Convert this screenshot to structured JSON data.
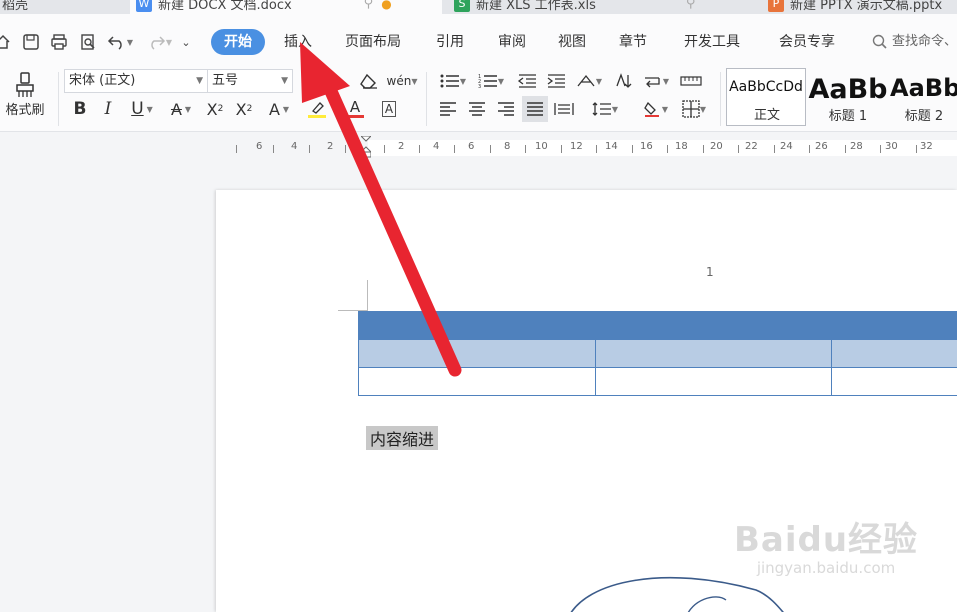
{
  "tabs": [
    {
      "label": "稻壳",
      "icon": "wps-logo-icon",
      "color": "#e0e3e8"
    },
    {
      "label": "新建 DOCX 文档.docx",
      "icon": "writer-doc-icon",
      "color": "#4a8ef0",
      "active": true
    },
    {
      "label": "新建 XLS 工作表.xls",
      "icon": "sheet-doc-icon",
      "color": "#2ea35c"
    },
    {
      "label": "新建 PPTX 演示文稿.pptx",
      "icon": "slides-doc-icon",
      "color": "#e8743b"
    }
  ],
  "menu": {
    "items": [
      "开始",
      "插入",
      "页面布局",
      "引用",
      "审阅",
      "视图",
      "章节",
      "开发工具",
      "会员专享"
    ],
    "active": "开始",
    "search_label": "查找命令、"
  },
  "ribbon": {
    "format_painter_label": "格式刷",
    "font_name": "宋体 (正文)",
    "font_size": "五号",
    "styles": [
      {
        "sample": "AaBbCcDd",
        "name": "正文"
      },
      {
        "sample": "AaBb",
        "name": "标题 1"
      },
      {
        "sample": "AaBb",
        "name": "标题 2"
      }
    ],
    "accent_color": "#4a90e2",
    "highlight_color": "#ffeb3b",
    "font_color": "#e53935"
  },
  "ruler": {
    "left_ticks": [
      "6",
      "4",
      "2"
    ],
    "right_ticks": [
      "2",
      "4",
      "6",
      "8",
      "10",
      "12",
      "14",
      "16",
      "18",
      "20",
      "22",
      "24",
      "26",
      "28",
      "30",
      "32"
    ]
  },
  "document": {
    "page_number": "1",
    "paragraph": "内容缩进",
    "table": {
      "header_color": "#4f81bd",
      "band_color": "#b8cce4",
      "rows": 3,
      "columns": 3
    }
  },
  "watermark": {
    "main": "Baidu经验",
    "sub": "jingyan.baidu.com"
  },
  "annotation": {
    "type": "red arrow",
    "color": "#e82530",
    "target": "插入"
  }
}
